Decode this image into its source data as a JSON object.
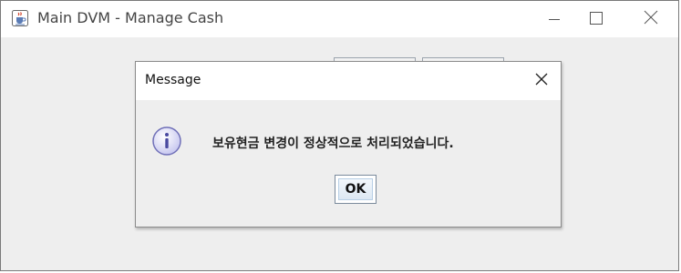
{
  "window": {
    "title": "Main DVM - Manage Cash",
    "app_icon": "java-cup-icon",
    "controls": {
      "minimize": "minimize-icon",
      "maximize": "maximize-icon",
      "close": "close-icon"
    }
  },
  "dialog": {
    "title": "Message",
    "icon": "info-icon",
    "message": "보유현금 변경이 정상적으로 처리되었습니다.",
    "ok_label": "OK",
    "close_icon": "close-icon"
  },
  "colors": {
    "info_icon_fill": "#c8c8f0",
    "info_icon_border": "#7070b8",
    "ok_border": "#7a8a9c",
    "background": "#eeeeee"
  }
}
